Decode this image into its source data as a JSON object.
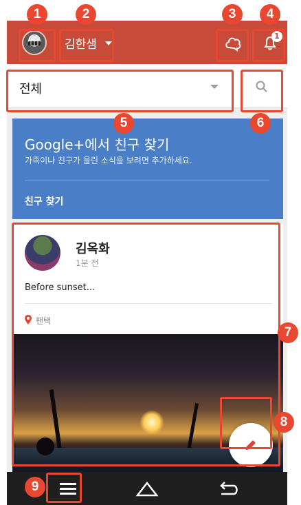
{
  "header": {
    "account_name": "김한샘",
    "notification_count": "1"
  },
  "filter": {
    "selected": "전체"
  },
  "google_card": {
    "title": "Google+에서 친구 찾기",
    "subtitle": "가족이나 친구가 올린 소식을 보려면 추가하세요.",
    "link": "친구 찾기"
  },
  "post": {
    "author": "김옥화",
    "time": "1분 전",
    "text": "Before sunset...",
    "location": "팬택"
  },
  "callouts": [
    "1",
    "2",
    "3",
    "4",
    "5",
    "6",
    "7",
    "8",
    "9"
  ],
  "icons": [
    "avatar",
    "caret-down-icon",
    "hangouts-icon",
    "bell-icon",
    "search-icon",
    "pin-icon",
    "pencil-icon",
    "menu-icon",
    "home-icon",
    "back-icon"
  ],
  "colors": {
    "app_bar": "#c84b3a",
    "google_card": "#4a7fc7",
    "callout": "#e9472f",
    "nav_bar": "#1f1f1f"
  }
}
